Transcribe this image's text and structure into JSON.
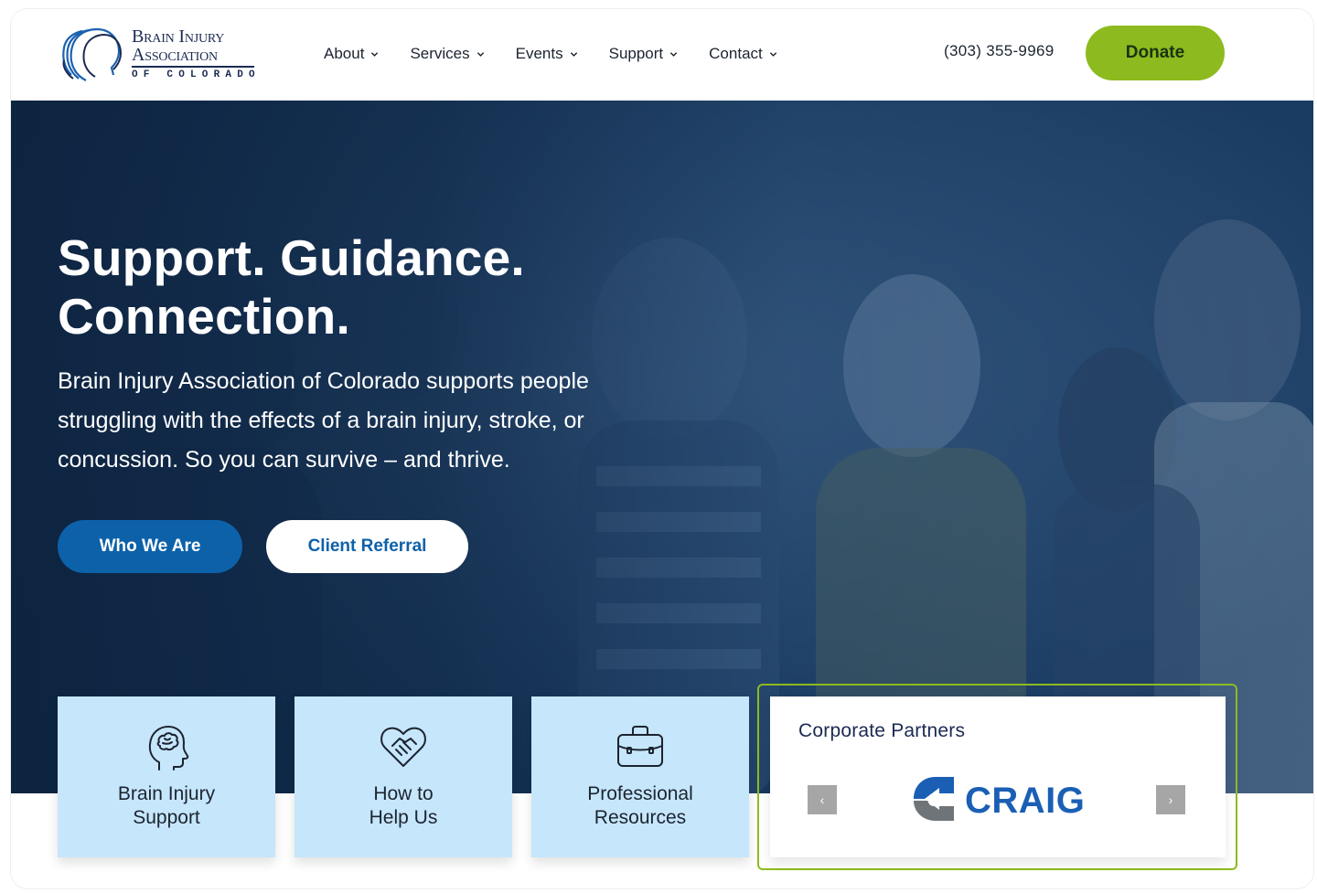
{
  "colors": {
    "brand_navy": "#1b2a52",
    "brand_blue": "#0d61a9",
    "accent_green": "#8dbb1f",
    "card_blue": "#c6e6fb",
    "hero_overlay": "#132c4d"
  },
  "header": {
    "logo": {
      "line1": "Brain Injury",
      "line2": "Association",
      "line3": "OF COLORADO",
      "icon": "head-profiles-logo-icon"
    },
    "nav": [
      {
        "label": "About",
        "icon": "chevron-down-icon"
      },
      {
        "label": "Services",
        "icon": "chevron-down-icon"
      },
      {
        "label": "Events",
        "icon": "chevron-down-icon"
      },
      {
        "label": "Support",
        "icon": "chevron-down-icon"
      },
      {
        "label": "Contact",
        "icon": "chevron-down-icon"
      }
    ],
    "phone": "(303) 355-9969",
    "donate_label": "Donate"
  },
  "hero": {
    "title_line1": "Support. Guidance.",
    "title_line2": "Connection.",
    "text_line1": "Brain Injury Association of Colorado supports people",
    "text_line2": "struggling with the effects of a brain injury, stroke, or",
    "text_line3": "concussion. So you can survive – and thrive.",
    "primary_button": "Who We Are",
    "secondary_button": "Client Referral"
  },
  "cards": [
    {
      "line1": "Brain Injury",
      "line2": "Support",
      "icon": "brain-head-icon"
    },
    {
      "line1": "How to",
      "line2": "Help Us",
      "icon": "heart-handshake-icon"
    },
    {
      "line1": "Professional",
      "line2": "Resources",
      "icon": "briefcase-icon"
    }
  ],
  "partners": {
    "title": "Corporate Partners",
    "prev_arrow": "‹",
    "next_arrow": "›",
    "current_logo_text": "CRAIG"
  }
}
